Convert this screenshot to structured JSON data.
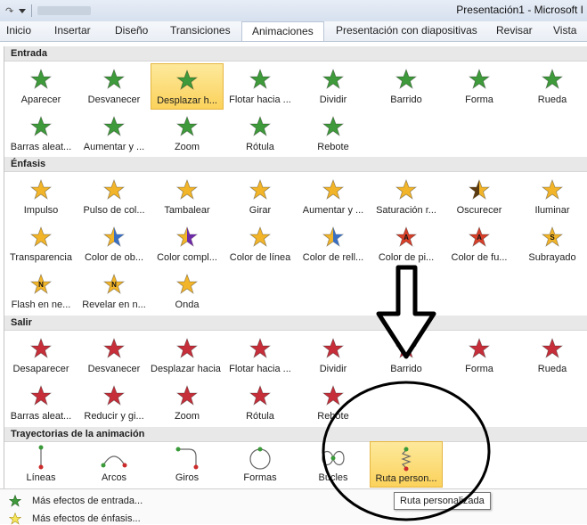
{
  "window": {
    "title": "Presentación1 - Microsoft I"
  },
  "colors": {
    "enter": "#3e9a3a",
    "emph": "#f2b52a",
    "exit": "#c62f3a",
    "path_dot": "#3a9a3a",
    "path_end": "#cc2b2b",
    "selected": "#fbd25b"
  },
  "tabs": [
    "Inicio",
    "Insertar",
    "Diseño",
    "Transiciones",
    "Animaciones",
    "Presentación con diapositivas",
    "Revisar",
    "Vista"
  ],
  "active_tab": "Animaciones",
  "sections": {
    "entrada": {
      "title": "Entrada",
      "items": [
        "Aparecer",
        "Desvanecer",
        "Desplazar h...",
        "Flotar hacia ...",
        "Dividir",
        "Barrido",
        "Forma",
        "Rueda",
        "Barras aleat...",
        "Aumentar y ...",
        "Zoom",
        "Rótula",
        "Rebote"
      ],
      "selected": "Desplazar h..."
    },
    "enfasis": {
      "title": "Énfasis",
      "items": [
        "Impulso",
        "Pulso de col...",
        "Tambalear",
        "Girar",
        "Aumentar y ...",
        "Saturación r...",
        "Oscurecer",
        "Iluminar",
        "Transparencia",
        "Color de ob...",
        "Color compl...",
        "Color de línea",
        "Color de rell...",
        "Color de pi...",
        "Color de fu...",
        "Subrayado",
        "Flash en ne...",
        "Revelar en n...",
        "Onda"
      ]
    },
    "salir": {
      "title": "Salir",
      "items": [
        "Desaparecer",
        "Desvanecer",
        "Desplazar hacia ...",
        "Flotar hacia ...",
        "Dividir",
        "Barrido",
        "Forma",
        "Rueda",
        "Barras aleat...",
        "Reducir y gi...",
        "Zoom",
        "Rótula",
        "Rebote"
      ]
    },
    "trayectorias": {
      "title": "Trayectorias de la animación",
      "items": [
        "Líneas",
        "Arcos",
        "Giros",
        "Formas",
        "Bucles",
        "Ruta person..."
      ],
      "selected": "Ruta person..."
    }
  },
  "more_effects": [
    "Más efectos de entrada...",
    "Más efectos de énfasis..."
  ],
  "tooltip": "Ruta personalizada",
  "letters": {
    "A": "A",
    "S": "S",
    "N": "N"
  }
}
